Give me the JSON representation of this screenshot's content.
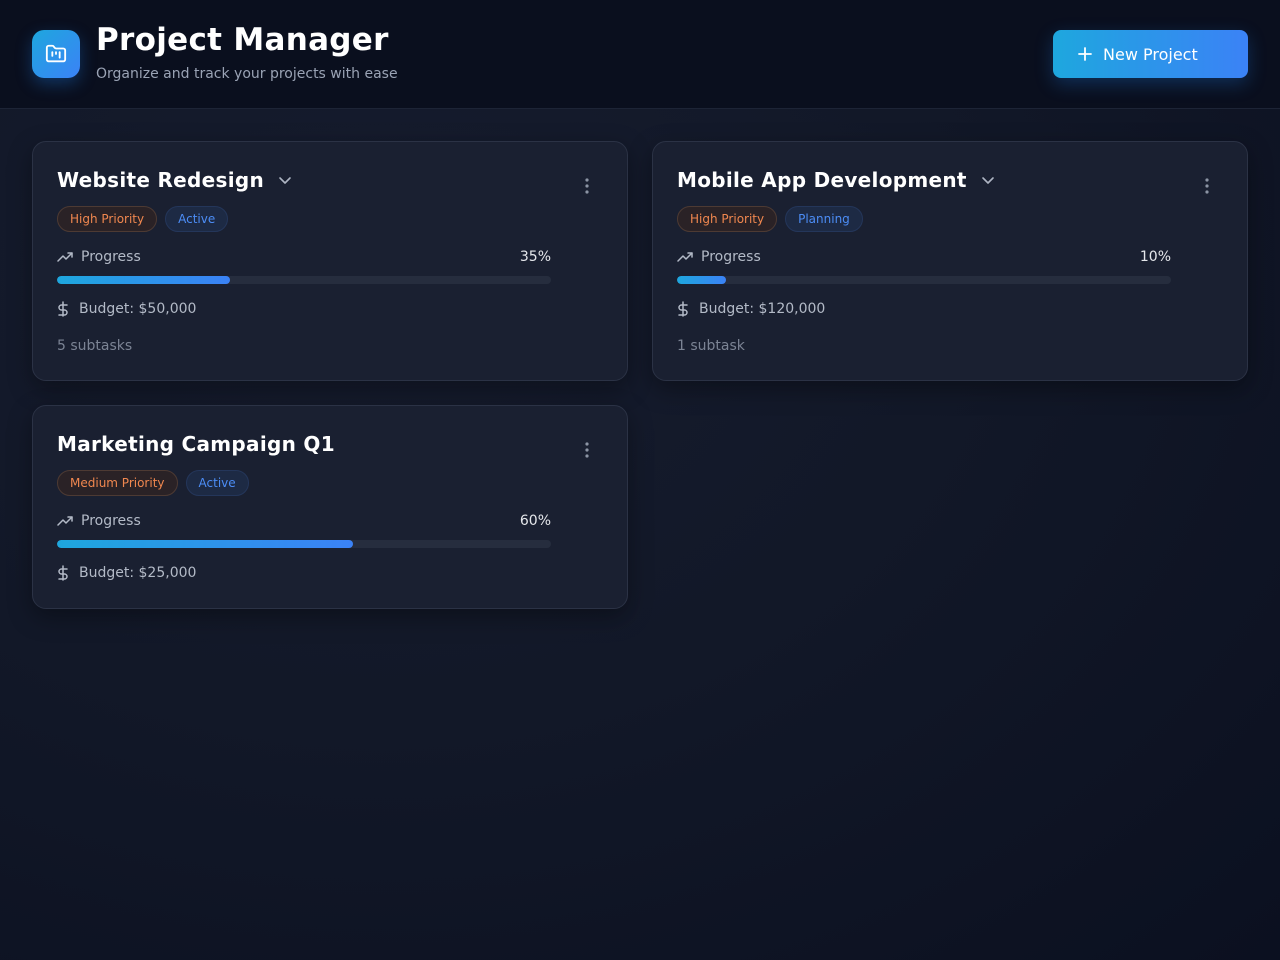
{
  "header": {
    "title": "Project Manager",
    "subtitle": "Organize and track your projects with ease",
    "logo_icon": "folder-kanban-icon",
    "new_project_label": "New Project"
  },
  "colors": {
    "accent_start": "#1ea7de",
    "accent_end": "#3b82f6",
    "priority_text": "#f0874f",
    "status_text": "#4c8df6",
    "card_bg": "#1a2031"
  },
  "projects": [
    {
      "title": "Website Redesign",
      "priority": "High Priority",
      "status": "Active",
      "progress_label": "Progress",
      "progress": 35,
      "progress_text": "35%",
      "budget": "Budget: $50,000",
      "subtasks": "5 subtasks"
    },
    {
      "title": "Mobile App Development",
      "priority": "High Priority",
      "status": "Planning",
      "progress_label": "Progress",
      "progress": 10,
      "progress_text": "10%",
      "budget": "Budget: $120,000",
      "subtasks": "1 subtask"
    },
    {
      "title": "Marketing Campaign Q1",
      "priority": "Medium Priority",
      "status": "Active",
      "progress_label": "Progress",
      "progress": 60,
      "progress_text": "60%",
      "budget": "Budget: $25,000"
    }
  ]
}
